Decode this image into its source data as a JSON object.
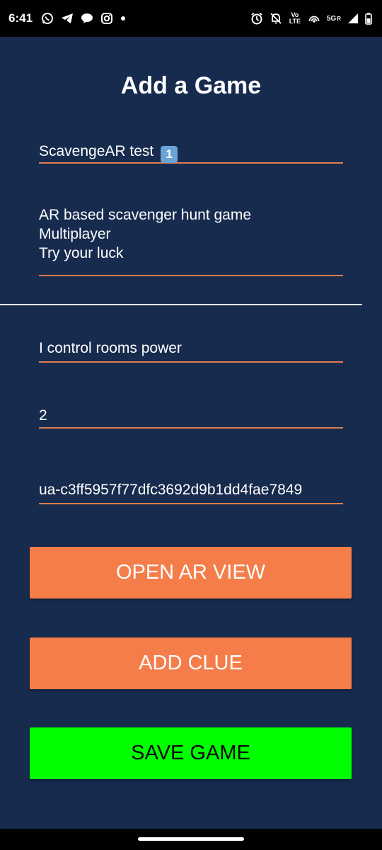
{
  "status_bar": {
    "time": "6:41",
    "left_icons": [
      "whatsapp-icon",
      "telegram-icon",
      "chat-bubble-icon",
      "instagram-icon",
      "dot-icon"
    ],
    "right_icons": [
      "alarm-icon",
      "notifications-off-icon",
      "volte-icon",
      "hotspot-icon",
      "signal-icon",
      "battery-icon"
    ],
    "volte_text": "Vo LTE",
    "network_text": "5G",
    "roaming_text": "R"
  },
  "page": {
    "title": "Add a Game"
  },
  "form": {
    "game_name": "ScavengeAR test",
    "game_name_emoji": "1",
    "description": "AR based scavenger hunt game\nMultiplayer\nTry your luck",
    "power": "I control rooms power",
    "count": "2",
    "game_id": "ua-c3ff5957f77dfc3692d9b1dd4fae7849"
  },
  "buttons": {
    "open_ar": "OPEN AR VIEW",
    "add_clue": "ADD CLUE",
    "save_game": "SAVE GAME"
  },
  "colors": {
    "background": "#172b4e",
    "accent_orange": "#f47d4a",
    "save_green": "#00ff00",
    "underline": "#e07d4f"
  }
}
